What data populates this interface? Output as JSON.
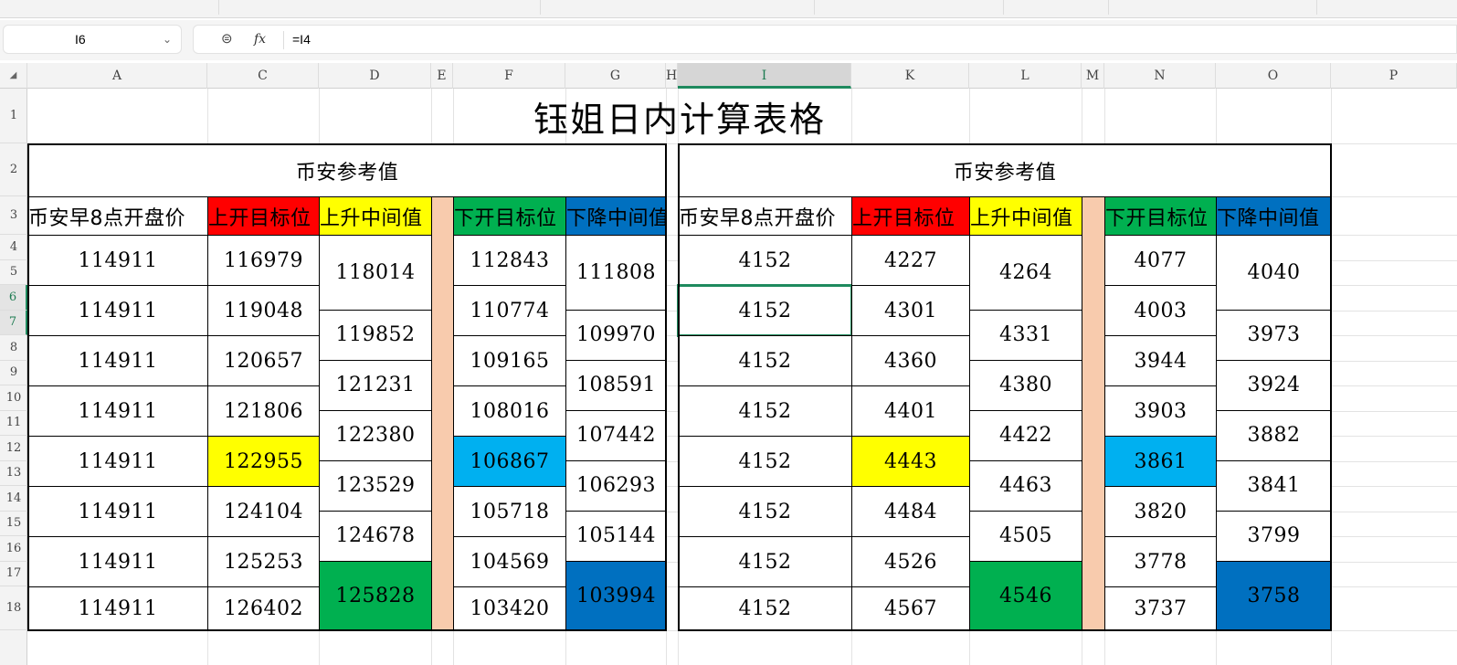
{
  "formula_bar": {
    "name_box": "I6",
    "formula": "=I4",
    "fx_label": "fx"
  },
  "columns": [
    "A",
    "C",
    "D",
    "E",
    "F",
    "G",
    "H",
    "I",
    "K",
    "L",
    "M",
    "N",
    "O",
    "P"
  ],
  "rows": [
    "1",
    "2",
    "3",
    "4",
    "5",
    "6",
    "7",
    "8",
    "9",
    "10",
    "11",
    "12",
    "13",
    "14",
    "15",
    "16",
    "17",
    "18"
  ],
  "sheet": {
    "title": "钰姐日内计算表格",
    "colors": {
      "red": "#ff0000",
      "yellow": "#ffff00",
      "green": "#00b050",
      "blue": "#0070c0",
      "lightblue": "#00b0f0",
      "peach": "#f8cbad"
    },
    "tables": [
      {
        "subtitle": "币安参考值",
        "headers": [
          "币安早8点开盘价",
          "上开目标位",
          "上升中间值",
          "下开目标位",
          "下降中间值"
        ],
        "open": [
          "114911",
          "114911",
          "114911",
          "114911",
          "114911",
          "114911",
          "114911",
          "114911"
        ],
        "up_target": [
          "116979",
          "119048",
          "120657",
          "121806",
          "122955",
          "124104",
          "125253",
          "126402"
        ],
        "up_mid": [
          "118014",
          "119852",
          "121231",
          "122380",
          "123529",
          "124678",
          "125828"
        ],
        "down_target": [
          "112843",
          "110774",
          "109165",
          "108016",
          "106867",
          "105718",
          "104569",
          "103420"
        ],
        "down_mid": [
          "111808",
          "109970",
          "108591",
          "107442",
          "106293",
          "105144",
          "103994"
        ]
      },
      {
        "subtitle": "币安参考值",
        "headers": [
          "币安早8点开盘价",
          "上开目标位",
          "上升中间值",
          "下开目标位",
          "下降中间值"
        ],
        "open": [
          "4152",
          "4152",
          "4152",
          "4152",
          "4152",
          "4152",
          "4152",
          "4152"
        ],
        "up_target": [
          "4227",
          "4301",
          "4360",
          "4401",
          "4443",
          "4484",
          "4526",
          "4567"
        ],
        "up_mid": [
          "4264",
          "4331",
          "4380",
          "4422",
          "4463",
          "4505",
          "4546"
        ],
        "down_target": [
          "4077",
          "4003",
          "3944",
          "3903",
          "3861",
          "3820",
          "3778",
          "3737"
        ],
        "down_mid": [
          "4040",
          "3973",
          "3924",
          "3882",
          "3841",
          "3799",
          "3758"
        ]
      }
    ]
  }
}
